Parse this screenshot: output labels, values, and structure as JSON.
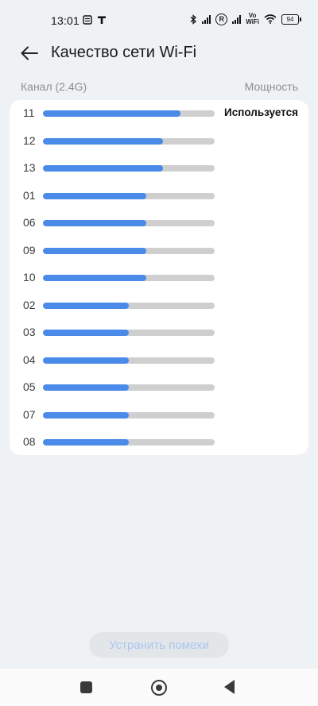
{
  "status_bar": {
    "time": "13:01",
    "vowifi_top": "Vo",
    "vowifi_bottom": "WiFi",
    "r_label": "R",
    "battery": "94"
  },
  "header": {
    "title": "Качество сети Wi-Fi"
  },
  "columns": {
    "channel_label": "Канал (2.4G)",
    "power_label": "Мощность"
  },
  "channels": [
    {
      "channel": "11",
      "strength": 0.8,
      "status": "Используется"
    },
    {
      "channel": "12",
      "strength": 0.7,
      "status": ""
    },
    {
      "channel": "13",
      "strength": 0.7,
      "status": ""
    },
    {
      "channel": "01",
      "strength": 0.6,
      "status": ""
    },
    {
      "channel": "06",
      "strength": 0.6,
      "status": ""
    },
    {
      "channel": "09",
      "strength": 0.6,
      "status": ""
    },
    {
      "channel": "10",
      "strength": 0.6,
      "status": ""
    },
    {
      "channel": "02",
      "strength": 0.5,
      "status": ""
    },
    {
      "channel": "03",
      "strength": 0.5,
      "status": ""
    },
    {
      "channel": "04",
      "strength": 0.5,
      "status": ""
    },
    {
      "channel": "05",
      "strength": 0.5,
      "status": ""
    },
    {
      "channel": "07",
      "strength": 0.5,
      "status": ""
    },
    {
      "channel": "08",
      "strength": 0.5,
      "status": ""
    }
  ],
  "actions": {
    "fix_interference": "Устранить помехи"
  },
  "colors": {
    "bar_fill": "#4a8ae8",
    "bar_track": "#cfcfcf",
    "background": "#eff2f4"
  },
  "icons": {
    "back": "arrow-left-icon",
    "nav_recent": "square-icon",
    "nav_home": "circle-icon",
    "nav_back": "triangle-back-icon"
  }
}
